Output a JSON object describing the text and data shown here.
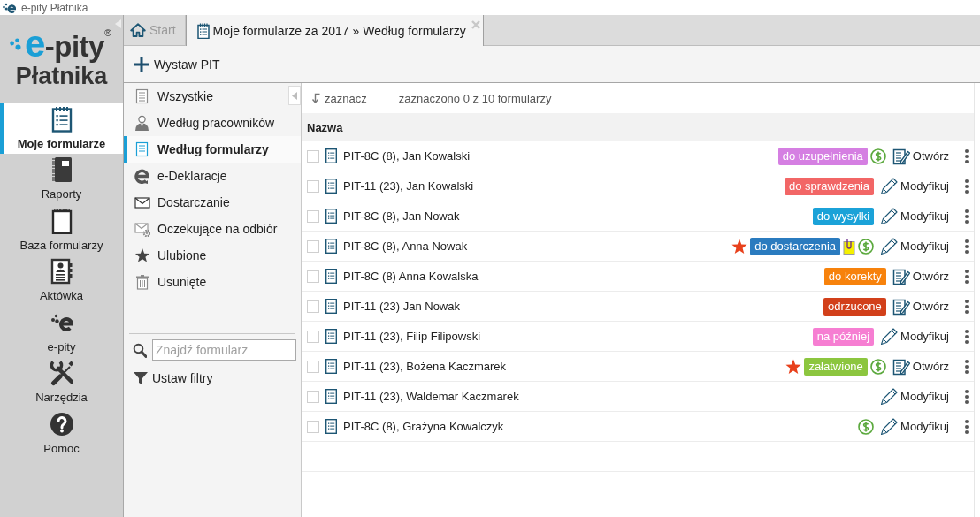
{
  "title_bar": {
    "title": "e-pity Płatnika"
  },
  "logo": {
    "mark": "e",
    "name": "-pity",
    "registered": "®",
    "subtitle": "Płatnika"
  },
  "sidebar": {
    "items": [
      {
        "label": "Moje formularze",
        "selected": true
      },
      {
        "label": "Raporty",
        "selected": false
      },
      {
        "label": "Baza formularzy",
        "selected": false
      },
      {
        "label": "Aktówka",
        "selected": false
      },
      {
        "label": "e-pity",
        "selected": false
      },
      {
        "label": "Narzędzia",
        "selected": false
      },
      {
        "label": "Pomoc",
        "selected": false
      }
    ]
  },
  "tabs": [
    {
      "label": "Start",
      "selected": false,
      "closable": false
    },
    {
      "label": "Moje formularze za 2017 » Według formularzy",
      "selected": true,
      "closable": true
    }
  ],
  "toolbar": {
    "buttons": [
      {
        "label": "Wystaw PIT"
      }
    ]
  },
  "views": {
    "items": [
      {
        "label": "Wszystkie",
        "selected": false
      },
      {
        "label": "Według pracowników",
        "selected": false
      },
      {
        "label": "Według formularzy",
        "selected": true
      },
      {
        "label": "e-Deklaracje",
        "selected": false
      },
      {
        "label": "Dostarczanie",
        "selected": false
      },
      {
        "label": "Oczekujące na odbiór",
        "selected": false
      },
      {
        "label": "Ulubione",
        "selected": false
      },
      {
        "label": "Usunięte",
        "selected": false
      }
    ],
    "search": {
      "placeholder": "Znajdź formularz"
    },
    "filter_link": "Ustaw filtry"
  },
  "table": {
    "select_button": "zaznacz",
    "selection_info": "zaznaczono 0 z 10 formularzy",
    "columns": [
      "Nazwa"
    ],
    "rows": [
      {
        "name": "PIT-8C (8), Jan Kowalski",
        "checked": false,
        "favorite": false,
        "status": {
          "label": "do uzupełnienia",
          "color": "#d57fe2"
        },
        "attachment": false,
        "paid": true,
        "action": {
          "kind": "open",
          "label": "Otwórz"
        }
      },
      {
        "name": "PIT-11 (23), Jan Kowalski",
        "checked": false,
        "favorite": false,
        "status": {
          "label": "do sprawdzenia",
          "color": "#f26666"
        },
        "attachment": false,
        "paid": false,
        "action": {
          "kind": "modify",
          "label": "Modyfikuj"
        }
      },
      {
        "name": "PIT-8C (8), Jan Nowak",
        "checked": false,
        "favorite": false,
        "status": {
          "label": "do wysyłki",
          "color": "#1ba2d8"
        },
        "attachment": false,
        "paid": false,
        "action": {
          "kind": "modify",
          "label": "Modyfikuj"
        }
      },
      {
        "name": "PIT-8C (8), Anna Nowak",
        "checked": false,
        "favorite": true,
        "status": {
          "label": "do dostarczenia",
          "color": "#2a7bbf"
        },
        "attachment": true,
        "paid": true,
        "action": {
          "kind": "modify",
          "label": "Modyfikuj"
        }
      },
      {
        "name": "PIT-8C (8) Anna Kowalska",
        "checked": false,
        "favorite": false,
        "status": {
          "label": "do korekty",
          "color": "#f7820c"
        },
        "attachment": false,
        "paid": false,
        "action": {
          "kind": "open",
          "label": "Otwórz"
        }
      },
      {
        "name": "PIT-11 (23) Jan Nowak",
        "checked": false,
        "favorite": false,
        "status": {
          "label": "odrzucone",
          "color": "#d2401a"
        },
        "attachment": false,
        "paid": false,
        "action": {
          "kind": "open",
          "label": "Otwórz"
        }
      },
      {
        "name": "PIT-11 (23), Filip Filipowski",
        "checked": false,
        "favorite": false,
        "status": {
          "label": "na później",
          "color": "#f67ed2"
        },
        "attachment": false,
        "paid": false,
        "action": {
          "kind": "modify",
          "label": "Modyfikuj"
        }
      },
      {
        "name": "PIT-11 (23), Bożena Kaczmarek",
        "checked": false,
        "favorite": true,
        "status": {
          "label": "załatwione",
          "color": "#8cc63f"
        },
        "attachment": false,
        "paid": true,
        "action": {
          "kind": "open",
          "label": "Otwórz"
        }
      },
      {
        "name": "PIT-11 (23), Waldemar Kaczmarek",
        "checked": false,
        "favorite": false,
        "attachment": false,
        "paid": false,
        "action": {
          "kind": "modify",
          "label": "Modyfikuj"
        }
      },
      {
        "name": "PIT-8C (8), Grażyna Kowalczyk",
        "checked": false,
        "favorite": false,
        "attachment": false,
        "paid": true,
        "action": {
          "kind": "modify",
          "label": "Modyfikuj"
        }
      }
    ]
  }
}
